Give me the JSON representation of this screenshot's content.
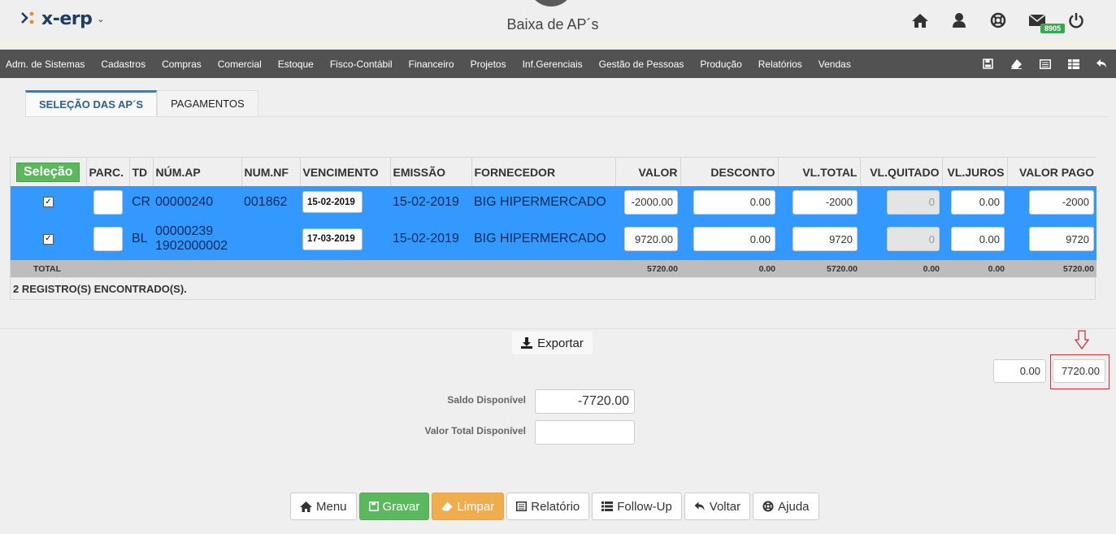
{
  "header": {
    "brand": "x-erp",
    "title": "Baixa de AP´s",
    "notification_count": "8905"
  },
  "menu": [
    "Adm. de Sistemas",
    "Cadastros",
    "Compras",
    "Comercial",
    "Estoque",
    "Fisco-Contábil",
    "Financeiro",
    "Projetos",
    "Inf.Gerenciais",
    "Gestão de Pessoas",
    "Produção",
    "Relatórios",
    "Vendas"
  ],
  "tabs": [
    "SELEÇÃO DAS AP´S",
    "PAGAMENTOS"
  ],
  "table": {
    "select_label": "Seleção",
    "columns": [
      "PARC.",
      "TD",
      "NÚM.AP",
      "NUM.NF",
      "VENCIMENTO",
      "EMISSÃO",
      "FORNECEDOR",
      "VALOR",
      "DESCONTO",
      "VL.TOTAL",
      "VL.QUITADO",
      "VL.JUROS",
      "VALOR PAGO"
    ],
    "rows": [
      {
        "td": "CR",
        "num_ap": "00000240",
        "num_ap2": "",
        "num_nf": "001862",
        "vencimento": "15-02-2019",
        "emissao": "15-02-2019",
        "fornecedor": "BIG HIPERMERCADO",
        "valor": "-2000.00",
        "desconto": "0.00",
        "vl_total": "-2000",
        "vl_quitado": "0",
        "vl_juros": "0.00",
        "valor_pago": "-2000"
      },
      {
        "td": "BL",
        "num_ap": "00000239",
        "num_ap2": "1902000002",
        "num_nf": "",
        "vencimento": "17-03-2019",
        "emissao": "15-02-2019",
        "fornecedor": "BIG HIPERMERCADO",
        "valor": "9720.00",
        "desconto": "0.00",
        "vl_total": "9720",
        "vl_quitado": "0",
        "vl_juros": "0.00",
        "valor_pago": "9720"
      }
    ],
    "total": {
      "label": "TOTAL",
      "valor": "5720.00",
      "desconto": "0.00",
      "vl_total": "5720.00",
      "vl_quitado": "0.00",
      "vl_juros": "0.00",
      "valor_pago": "5720.00"
    },
    "records_found": "2 REGISTRO(S) ENCONTRADO(S)."
  },
  "export_label": "Exportar",
  "summary": {
    "left": "0.00",
    "right": "7720.00"
  },
  "form": {
    "saldo_label": "Saldo Disponível",
    "saldo_value": "-7720.00",
    "valor_total_label": "Valor Total Disponível",
    "valor_total_value": ""
  },
  "buttons": [
    "Menu",
    "Gravar",
    "Limpar",
    "Relatório",
    "Follow-Up",
    "Voltar",
    "Ajuda"
  ],
  "colors": {
    "row_selected": "#3399ff",
    "menubar": "#525252",
    "green": "#5cb85c",
    "orange": "#f0ad4e",
    "highlight": "#cc3333"
  }
}
